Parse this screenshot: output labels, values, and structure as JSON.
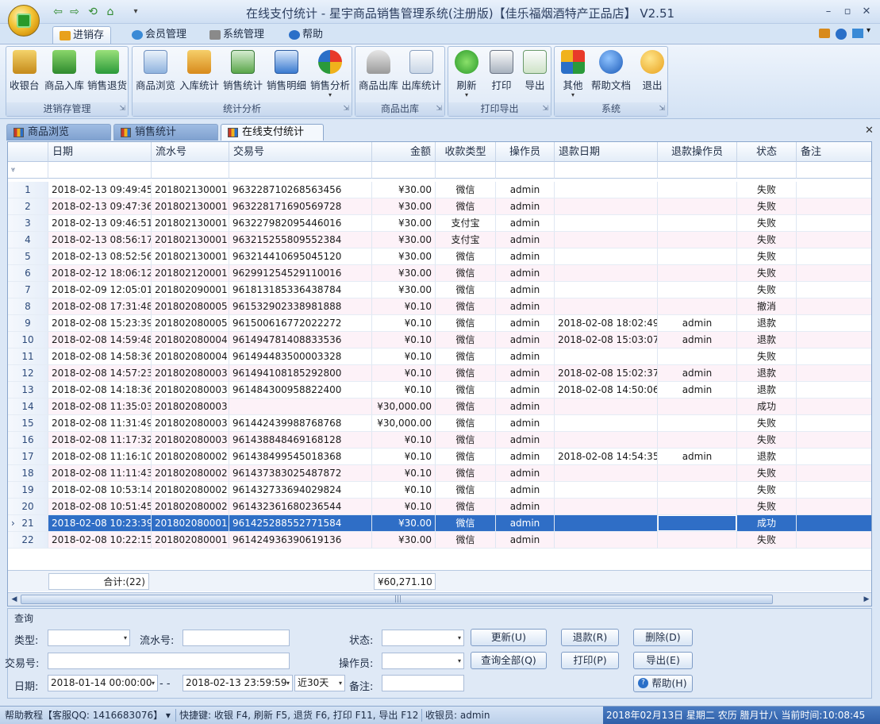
{
  "window": {
    "title": "在线支付统计 - 星宇商品销售管理系统(注册版)【佳乐福烟酒特产正品店】 V2.51",
    "minimize": "–",
    "maximize": "▫",
    "close": "✕"
  },
  "quick_access": [
    "⇦",
    "⇨",
    "⟲",
    "⌂",
    "▾"
  ],
  "ribbon_tabs": [
    "进销存",
    "会员管理",
    "系统管理",
    "帮助"
  ],
  "ribbon_groups": [
    {
      "label": "进销存管理",
      "buttons": [
        "收银台",
        "商品入库",
        "销售退货"
      ]
    },
    {
      "label": "统计分析",
      "buttons": [
        "商品浏览",
        "入库统计",
        "销售统计",
        "销售明细",
        "销售分析"
      ]
    },
    {
      "label": "商品出库",
      "buttons": [
        "商品出库",
        "出库统计"
      ]
    },
    {
      "label": "打印导出",
      "buttons": [
        "刷新",
        "打印",
        "导出"
      ]
    },
    {
      "label": "系统",
      "buttons": [
        "其他",
        "帮助文档",
        "退出"
      ]
    }
  ],
  "doc_tabs": [
    "商品浏览",
    "销售统计",
    "在线支付统计"
  ],
  "grid": {
    "columns": [
      "日期",
      "流水号",
      "交易号",
      "金额",
      "收款类型",
      "操作员",
      "退款日期",
      "退款操作员",
      "状态",
      "备注"
    ],
    "rows": [
      [
        "1",
        "2018-02-13 09:49:45",
        "201802130001",
        "963228710268563456",
        "¥30.00",
        "微信",
        "admin",
        "",
        "",
        "失败",
        ""
      ],
      [
        "2",
        "2018-02-13 09:47:36",
        "201802130001",
        "963228171690569728",
        "¥30.00",
        "微信",
        "admin",
        "",
        "",
        "失败",
        ""
      ],
      [
        "3",
        "2018-02-13 09:46:51",
        "201802130001",
        "963227982095446016",
        "¥30.00",
        "支付宝",
        "admin",
        "",
        "",
        "失败",
        ""
      ],
      [
        "4",
        "2018-02-13 08:56:17",
        "201802130001",
        "963215255809552384",
        "¥30.00",
        "支付宝",
        "admin",
        "",
        "",
        "失败",
        ""
      ],
      [
        "5",
        "2018-02-13 08:52:56",
        "201802130001",
        "963214410695045120",
        "¥30.00",
        "微信",
        "admin",
        "",
        "",
        "失败",
        ""
      ],
      [
        "6",
        "2018-02-12 18:06:12",
        "201802120001",
        "962991254529110016",
        "¥30.00",
        "微信",
        "admin",
        "",
        "",
        "失败",
        ""
      ],
      [
        "7",
        "2018-02-09 12:05:01",
        "201802090001",
        "961813185336438784",
        "¥30.00",
        "微信",
        "admin",
        "",
        "",
        "失败",
        ""
      ],
      [
        "8",
        "2018-02-08 17:31:48",
        "201802080005",
        "961532902338981888",
        "¥0.10",
        "微信",
        "admin",
        "",
        "",
        "撤消",
        ""
      ],
      [
        "9",
        "2018-02-08 15:23:39",
        "201802080005",
        "961500616772022272",
        "¥0.10",
        "微信",
        "admin",
        "2018-02-08 18:02:49",
        "admin",
        "退款",
        ""
      ],
      [
        "10",
        "2018-02-08 14:59:48",
        "201802080004",
        "961494781408833536",
        "¥0.10",
        "微信",
        "admin",
        "2018-02-08 15:03:07",
        "admin",
        "退款",
        ""
      ],
      [
        "11",
        "2018-02-08 14:58:36",
        "201802080004",
        "961494483500003328",
        "¥0.10",
        "微信",
        "admin",
        "",
        "",
        "失败",
        ""
      ],
      [
        "12",
        "2018-02-08 14:57:23",
        "201802080003",
        "961494108185292800",
        "¥0.10",
        "微信",
        "admin",
        "2018-02-08 15:02:37",
        "admin",
        "退款",
        ""
      ],
      [
        "13",
        "2018-02-08 14:18:36",
        "201802080003",
        "961484300958822400",
        "¥0.10",
        "微信",
        "admin",
        "2018-02-08 14:50:06",
        "admin",
        "退款",
        ""
      ],
      [
        "14",
        "2018-02-08 11:35:03",
        "201802080003",
        "",
        "¥30,000.00",
        "微信",
        "admin",
        "",
        "",
        "成功",
        ""
      ],
      [
        "15",
        "2018-02-08 11:31:49",
        "201802080003",
        "961442439988768768",
        "¥30,000.00",
        "微信",
        "admin",
        "",
        "",
        "失败",
        ""
      ],
      [
        "16",
        "2018-02-08 11:17:32",
        "201802080003",
        "961438848469168128",
        "¥0.10",
        "微信",
        "admin",
        "",
        "",
        "失败",
        ""
      ],
      [
        "17",
        "2018-02-08 11:16:10",
        "201802080002",
        "961438499545018368",
        "¥0.10",
        "微信",
        "admin",
        "2018-02-08 14:54:35",
        "admin",
        "退款",
        ""
      ],
      [
        "18",
        "2018-02-08 11:11:43",
        "201802080002",
        "961437383025487872",
        "¥0.10",
        "微信",
        "admin",
        "",
        "",
        "失败",
        ""
      ],
      [
        "19",
        "2018-02-08 10:53:14",
        "201802080002",
        "961432733694029824",
        "¥0.10",
        "微信",
        "admin",
        "",
        "",
        "失败",
        ""
      ],
      [
        "20",
        "2018-02-08 10:51:45",
        "201802080002",
        "961432361680236544",
        "¥0.10",
        "微信",
        "admin",
        "",
        "",
        "失败",
        ""
      ],
      [
        "21",
        "2018-02-08 10:23:39",
        "201802080001",
        "961425288552771584",
        "¥30.00",
        "微信",
        "admin",
        "",
        "",
        "成功",
        ""
      ],
      [
        "22",
        "2018-02-08 10:22:15",
        "201802080001",
        "961424936390619136",
        "¥30.00",
        "微信",
        "admin",
        "",
        "",
        "失败",
        ""
      ]
    ],
    "selected_row": 21,
    "row_marker": "›",
    "total_label": "合计:(22)",
    "total_amount": "¥60,271.10"
  },
  "query": {
    "title": "查询",
    "type_label": "类型:",
    "type_value": "",
    "serial_label": "流水号:",
    "serial_value": "",
    "status_label": "状态:",
    "status_value": "",
    "txn_label": "交易号:",
    "txn_value": "",
    "operator_label": "操作员:",
    "operator_value": "",
    "date_label": "日期:",
    "date_from": "2018-01-14 00:00:00",
    "date_sep": "- -",
    "date_to": "2018-02-13 23:59:59",
    "range_value": "近30天",
    "remark_label": "备注:",
    "remark_value": "",
    "btn_refresh": "更新(U)",
    "btn_query_all": "查询全部(Q)",
    "btn_refund": "退款(R)",
    "btn_print": "打印(P)",
    "btn_delete": "删除(D)",
    "btn_export": "导出(E)",
    "btn_help": "帮助(H)"
  },
  "status": {
    "help": "帮助教程【客服QQ: 1416683076】",
    "shortcuts": "快捷键: 收银 F4, 刷新 F5, 退货 F6, 打印 F11, 导出 F12",
    "cashier": "收银员: admin",
    "datetime": "2018年02月13日 星期二 农历 腊月廿八 当前时间:10:08:45"
  },
  "colors": {
    "selection": "#2f6ec6",
    "alt_row": "#fdf2f8",
    "ribbon": "#d3e2f4"
  }
}
